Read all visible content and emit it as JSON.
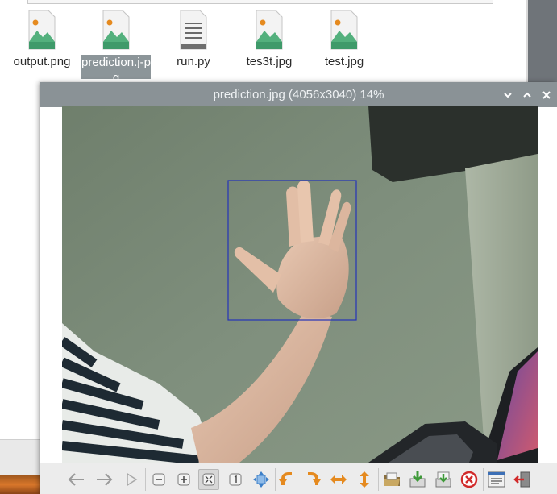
{
  "file_manager": {
    "files": [
      {
        "name": "output.png",
        "type": "image-icon",
        "selected": false
      },
      {
        "name": "prediction.j-pg",
        "type": "image-icon",
        "selected": true
      },
      {
        "name": "run.py",
        "type": "text-file-icon",
        "selected": false
      },
      {
        "name": "tes3t.jpg",
        "type": "image-icon",
        "selected": false
      },
      {
        "name": "test.jpg",
        "type": "image-icon",
        "selected": false
      }
    ]
  },
  "viewer": {
    "title": "prediction.jpg (4056x3040) 14%",
    "title_buttons": {
      "minimize": "⌄",
      "maximize": "⌃",
      "close": "✕"
    },
    "image": {
      "description_icon": "photo-of-raised-hand-with-bounding-box",
      "box_color": "#2433b8"
    },
    "toolbar": [
      "back-arrow-icon",
      "forward-arrow-icon",
      "play-slideshow-icon",
      "zoom-out-icon",
      "zoom-in-icon",
      "fit-to-window-icon",
      "original-size-icon",
      "full-screen-icon",
      "rotate-left-icon",
      "rotate-right-icon",
      "flip-horizontal-icon",
      "flip-vertical-icon",
      "open-file-icon",
      "save-file-icon",
      "save-as-icon",
      "delete-icon",
      "preferences-icon",
      "quit-icon"
    ]
  },
  "colors": {
    "titlebar": "#8a9296",
    "selection": "#8c9599",
    "icon_green": "#3f9a6a",
    "icon_orange": "#e58a1f"
  }
}
